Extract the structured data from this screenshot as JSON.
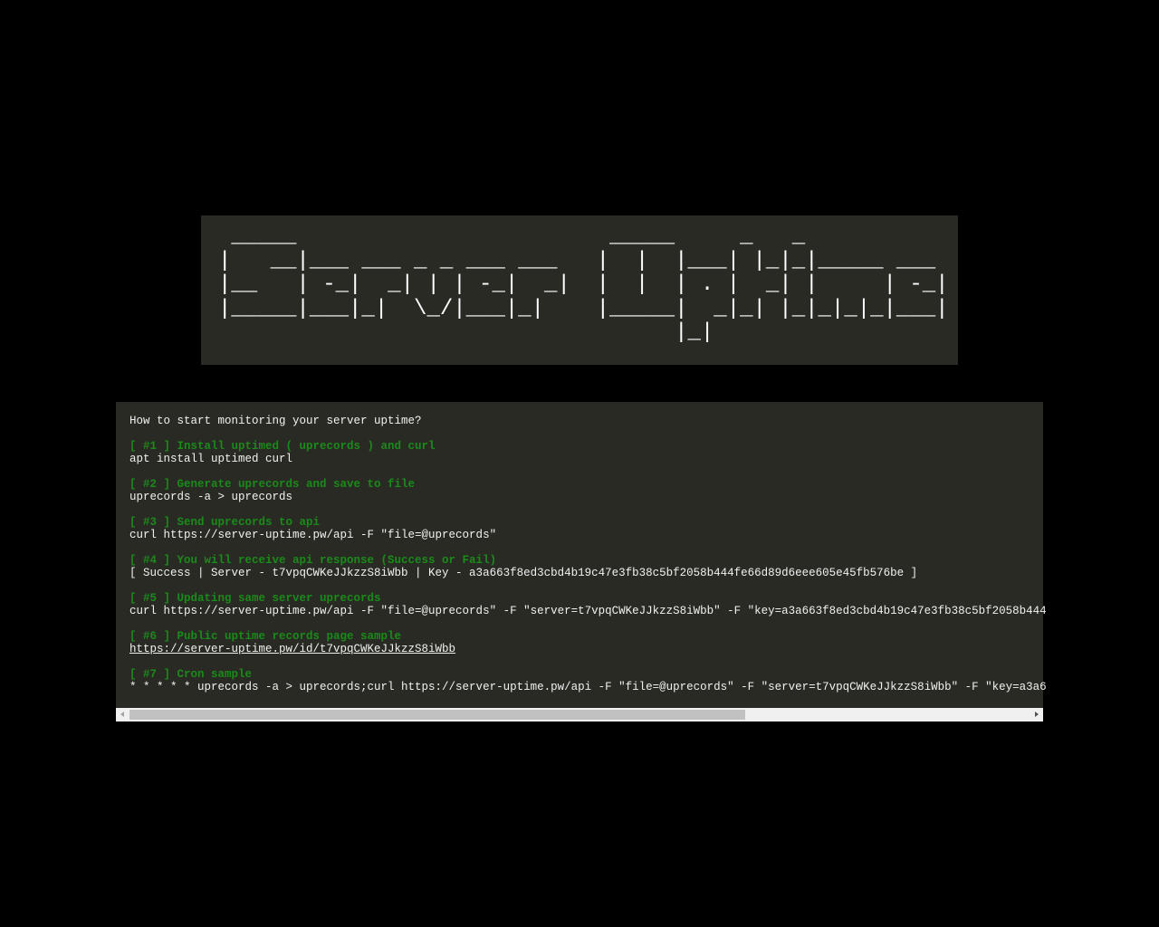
{
  "banner": {
    "ascii_art": " _____                        _____     _   _           \n|   __|___ ___ _ _ ___ ___   |  |  |___| |_|_|_____ ___ \n|__   | -_|  _| | | -_|  _|  |  |  | . |  _| |     | -_|\n|_____|___|_|  \\_/|___|_|    |_____|  _|_| |_|_|_|_|___|\n                                   |_|                  "
  },
  "intro": "How to start monitoring your server uptime?",
  "steps": [
    {
      "heading": "[ #1 ] Install uptimed ( uprecords ) and curl",
      "body": "apt install uptimed curl"
    },
    {
      "heading": "[ #2 ] Generate uprecords and save to file",
      "body": "uprecords -a > uprecords"
    },
    {
      "heading": "[ #3 ] Send uprecords to api",
      "body": "curl https://server-uptime.pw/api -F \"file=@uprecords\""
    },
    {
      "heading": "[ #4 ] You will receive api response (Success or Fail)",
      "body": "[ Success | Server - t7vpqCWKeJJkzzS8iWbb | Key - a3a663f8ed3cbd4b19c47e3fb38c5bf2058b444fe66d89d6eee605e45fb576be ]"
    },
    {
      "heading": "[ #5 ] Updating same server uprecords",
      "body": "curl https://server-uptime.pw/api -F \"file=@uprecords\" -F \"server=t7vpqCWKeJJkzzS8iWbb\" -F \"key=a3a663f8ed3cbd4b19c47e3fb38c5bf2058b444"
    },
    {
      "heading": "[ #6 ] Public uptime records page sample",
      "body": "https://server-uptime.pw/id/t7vpqCWKeJJkzzS8iWbb"
    },
    {
      "heading": "[ #7 ] Cron sample",
      "body": "* * * * * uprecords -a > uprecords;curl https://server-uptime.pw/api -F \"file=@uprecords\" -F \"server=t7vpqCWKeJJkzzS8iWbb\" -F \"key=a3a6"
    }
  ],
  "colors": {
    "background": "#000000",
    "panel": "#2a2a25",
    "heading": "#1a8a1a",
    "text": "#f0f0f0"
  },
  "scrollbar": {
    "horizontal_position_percent": 0
  }
}
